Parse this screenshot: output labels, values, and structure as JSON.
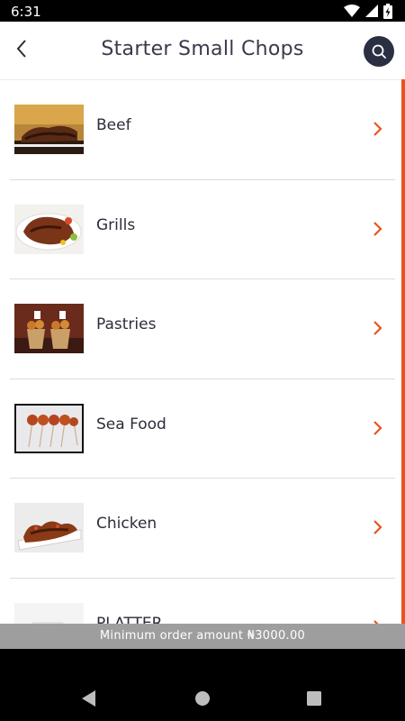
{
  "status_bar": {
    "time": "6:31"
  },
  "header": {
    "title": "Starter Small Chops"
  },
  "categories": [
    {
      "label": "Beef"
    },
    {
      "label": "Grills"
    },
    {
      "label": "Pastries"
    },
    {
      "label": "Sea Food"
    },
    {
      "label": "Chicken"
    },
    {
      "label": "PLATTER"
    }
  ],
  "footer": {
    "min_order_text": "Minimum order amount ₦3000.00"
  },
  "colors": {
    "accent": "#e8541e",
    "search_bg": "#2b2f42",
    "title_text": "#3a3a4a",
    "banner_bg": "#9e9e9e"
  },
  "icons": {
    "back": "arrow-left-icon",
    "search": "search-icon",
    "row_action": "chevron-right-icon"
  }
}
